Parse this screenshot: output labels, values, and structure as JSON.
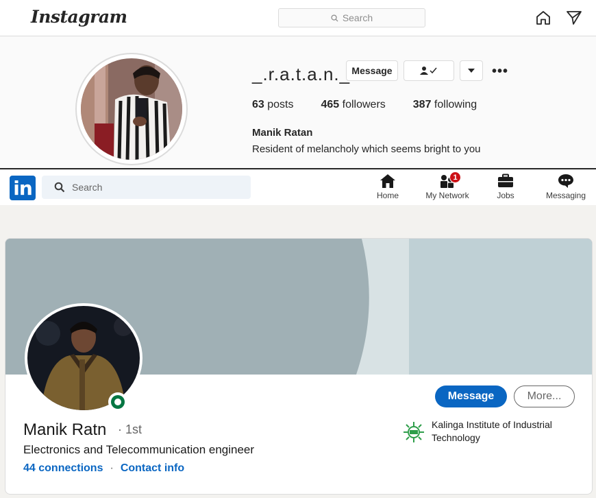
{
  "instagram": {
    "logo": "Instagram",
    "search_placeholder": "Search",
    "username": "_.r.a.t.a.n._",
    "message_button": "Message",
    "stats": {
      "posts_count": "63",
      "posts_label": " posts",
      "followers_count": "465",
      "followers_label": " followers",
      "following_count": "387",
      "following_label": " following"
    },
    "full_name": "Manik Ratan",
    "bio": "Resident of melancholy which seems bright to you"
  },
  "linkedin": {
    "logo": "in",
    "search_placeholder": "Search",
    "nav": {
      "home": "Home",
      "network": "My Network",
      "network_badge": "1",
      "jobs": "Jobs",
      "messaging": "Messaging"
    },
    "profile": {
      "name": "Manik Ratn",
      "degree": "· 1st",
      "headline": "Electronics and Telecommunication engineer",
      "connections": "44 connections",
      "separator": "·",
      "contact_info": "Contact info",
      "message_button": "Message",
      "more_button": "More...",
      "school": "Kalinga Institute of Industrial Technology"
    },
    "colors": {
      "brand": "#0a66c2",
      "online": "#057642",
      "badge": "#cc1016"
    }
  }
}
